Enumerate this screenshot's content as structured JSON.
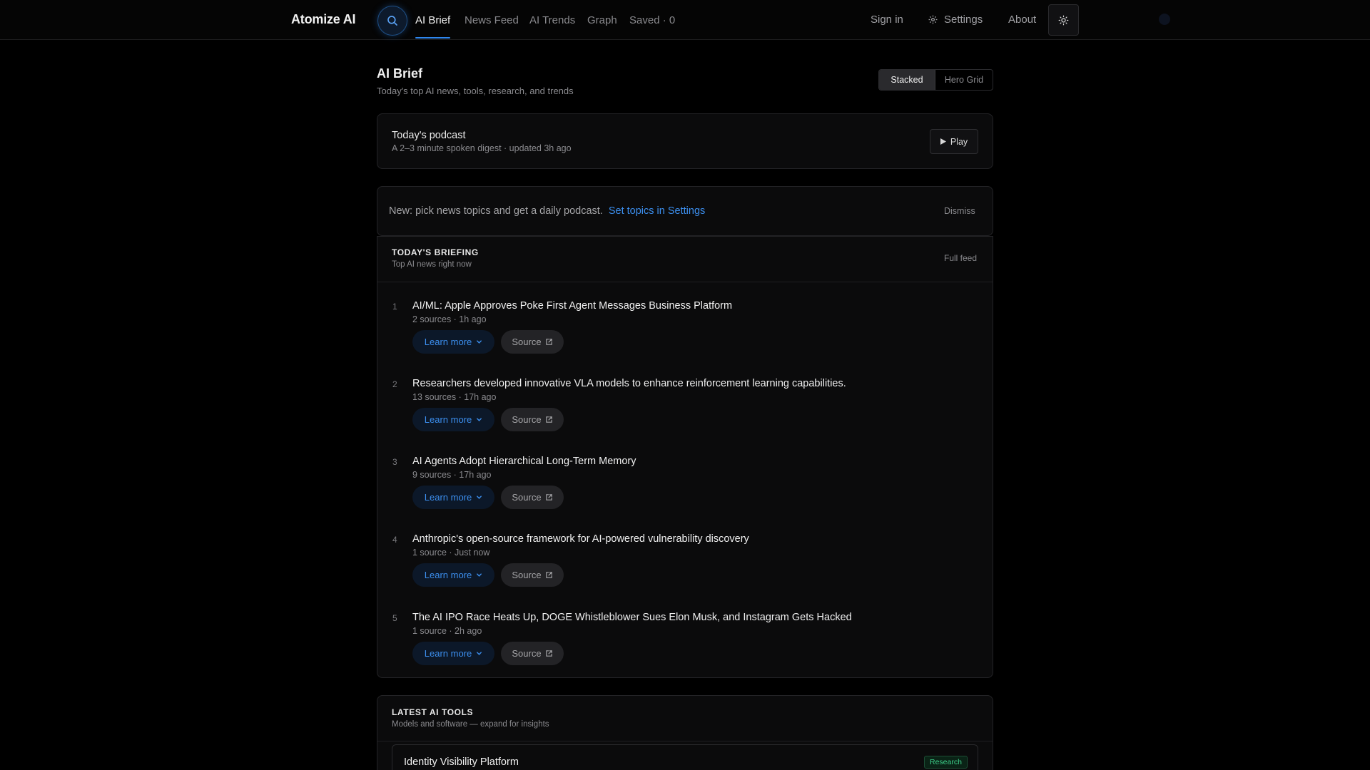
{
  "app": {
    "brand": "Atomize AI"
  },
  "nav": {
    "tabs": [
      {
        "label": "AI Brief",
        "active": true
      },
      {
        "label": "News Feed"
      },
      {
        "label": "AI Trends"
      },
      {
        "label": "Graph"
      },
      {
        "label": "Saved · 0"
      }
    ],
    "sign_in": "Sign in",
    "settings": "Settings",
    "about": "About"
  },
  "page": {
    "title": "AI Brief",
    "subtitle": "Today's top AI news, tools, research, and trends",
    "view_toggle": {
      "stacked": "Stacked",
      "hero_grid": "Hero Grid",
      "selected": "Stacked"
    }
  },
  "podcast": {
    "title": "Today's podcast",
    "subtitle": "A 2–3 minute spoken digest · updated 3h ago",
    "play_label": "Play"
  },
  "notice": {
    "text": "New: pick news topics and get a daily podcast.",
    "link": "Set topics in Settings",
    "dismiss": "Dismiss"
  },
  "briefing": {
    "title": "TODAY'S BRIEFING",
    "subtitle": "Top AI news right now",
    "full_feed": "Full feed",
    "learn_more": "Learn more",
    "source": "Source",
    "items": [
      {
        "num": "1",
        "title": "AI/ML: Apple Approves Poke First Agent Messages Business Platform",
        "meta": "2 sources · 1h ago"
      },
      {
        "num": "2",
        "title": "Researchers developed innovative VLA models to enhance reinforcement learning capabilities.",
        "meta": "13 sources · 17h ago"
      },
      {
        "num": "3",
        "title": "AI Agents Adopt Hierarchical Long-Term Memory",
        "meta": "9 sources · 17h ago"
      },
      {
        "num": "4",
        "title": "Anthropic's open-source framework for AI-powered vulnerability discovery",
        "meta": "1 source · Just now"
      },
      {
        "num": "5",
        "title": "The AI IPO Race Heats Up, DOGE Whistleblower Sues Elon Musk, and Instagram Gets Hacked",
        "meta": "1 source · 2h ago"
      }
    ]
  },
  "tools": {
    "title": "LATEST AI TOOLS",
    "subtitle": "Models and software — expand for insights",
    "items": [
      {
        "name": "Identity Visibility Platform",
        "badge": "Research"
      }
    ]
  },
  "colors": {
    "accent": "#2f87ee",
    "link": "#3c8fef",
    "background": "#000000",
    "badge_green": "#3ed08a"
  }
}
